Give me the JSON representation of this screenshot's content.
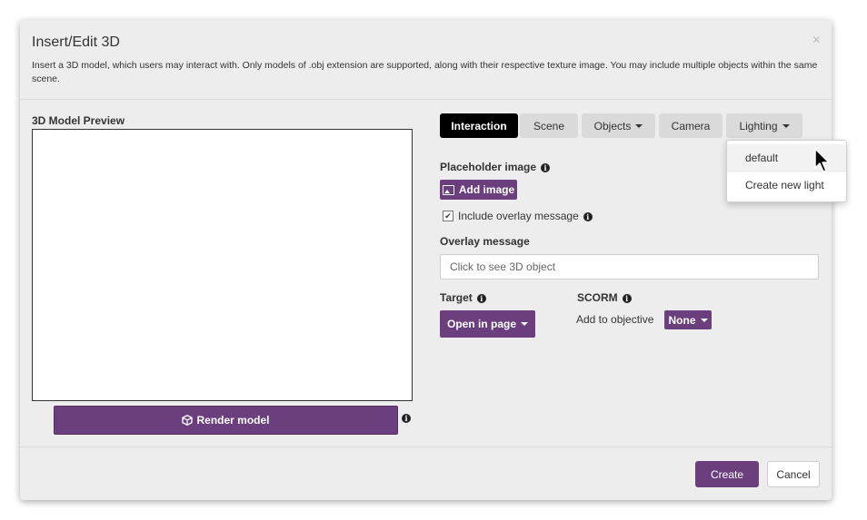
{
  "dialog": {
    "title": "Insert/Edit 3D",
    "close": "×",
    "description": "Insert a 3D model, which users may interact with. Only models of .obj extension are supported, along with their respective texture image. You may include multiple objects within the same scene."
  },
  "preview": {
    "label": "3D Model Preview",
    "render_button": "Render model"
  },
  "tabs": [
    {
      "label": "Interaction",
      "active": true
    },
    {
      "label": "Scene"
    },
    {
      "label": "Objects",
      "dropdown": true
    },
    {
      "label": "Camera"
    },
    {
      "label": "Lighting",
      "dropdown": true
    }
  ],
  "lighting_menu": {
    "items": [
      "default",
      "Create new light"
    ]
  },
  "placeholder": {
    "label": "Placeholder image",
    "button": "Add image"
  },
  "overlay": {
    "checkbox_label": "Include overlay message",
    "checked": true,
    "message_label": "Overlay message",
    "message_placeholder": "Click to see 3D object"
  },
  "target": {
    "label": "Target",
    "button": "Open in page"
  },
  "scorm": {
    "label": "SCORM",
    "objective_label": "Add to objective",
    "objective_value": "None"
  },
  "footer": {
    "create": "Create",
    "cancel": "Cancel"
  },
  "colors": {
    "accent": "#6b3f7d",
    "active_tab": "#000000",
    "tab": "#dadada",
    "dialog_bg": "#ededed"
  },
  "icons": {
    "info": "info-icon",
    "cube": "cube-icon",
    "image": "image-icon",
    "close": "close-icon"
  }
}
